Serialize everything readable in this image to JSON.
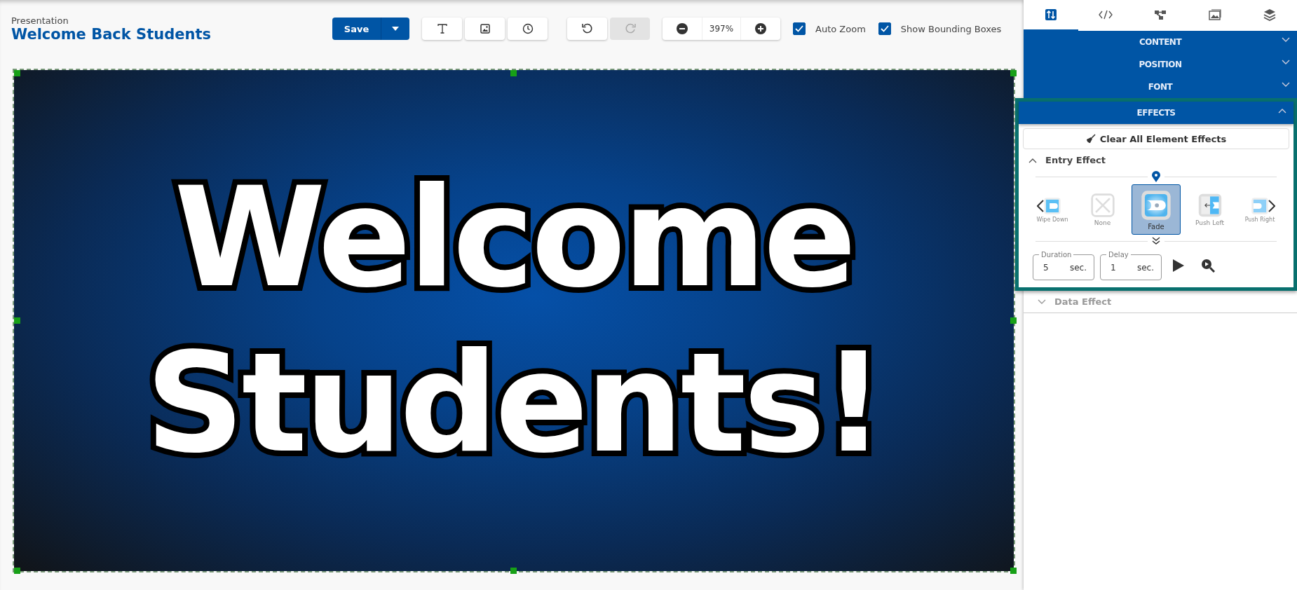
{
  "document": {
    "caption": "Presentation",
    "title": "Welcome Back Students"
  },
  "toolbar": {
    "save": "Save",
    "tools": [
      {
        "kind": "text",
        "disabled": false
      },
      {
        "kind": "image",
        "disabled": false
      },
      {
        "kind": "clock",
        "disabled": false
      }
    ],
    "history": [
      {
        "kind": "undo",
        "disabled": false
      },
      {
        "kind": "redo",
        "disabled": true
      }
    ],
    "zoom": "397%",
    "checkboxes": [
      {
        "label": "Auto Zoom",
        "checked": true
      },
      {
        "label": "Show Bounding Boxes",
        "checked": true
      }
    ]
  },
  "slide": {
    "lines": [
      "Welcome",
      "Students!"
    ],
    "selected": true
  },
  "panel": {
    "tabs": [
      {
        "kind": "properties",
        "selected": true
      },
      {
        "kind": "code",
        "selected": false
      },
      {
        "kind": "nodes",
        "selected": false
      },
      {
        "kind": "media",
        "selected": false
      },
      {
        "kind": "layers",
        "selected": false
      }
    ],
    "sections": [
      {
        "label": "CONTENT",
        "expanded": false
      },
      {
        "label": "POSITION",
        "expanded": false
      },
      {
        "label": "FONT",
        "expanded": false
      },
      {
        "label": "EFFECTS",
        "expanded": true
      }
    ],
    "effects": {
      "clear_button": "Clear All Element Effects",
      "entry": {
        "label": "Entry Effect",
        "expanded": true,
        "options": [
          {
            "label": "Wipe Down",
            "kind": "wipe-down",
            "selected": false
          },
          {
            "label": "None",
            "kind": "none",
            "selected": false
          },
          {
            "label": "Fade",
            "kind": "fade",
            "selected": true
          },
          {
            "label": "Push Left",
            "kind": "push-left",
            "selected": false
          },
          {
            "label": "Push Right",
            "kind": "push-right",
            "selected": false
          }
        ],
        "duration": {
          "label": "Duration",
          "value": "5",
          "unit": "sec."
        },
        "delay": {
          "label": "Delay",
          "value": "1",
          "unit": "sec."
        }
      },
      "data_effect": {
        "label": "Data Effect",
        "expanded": false
      }
    }
  }
}
